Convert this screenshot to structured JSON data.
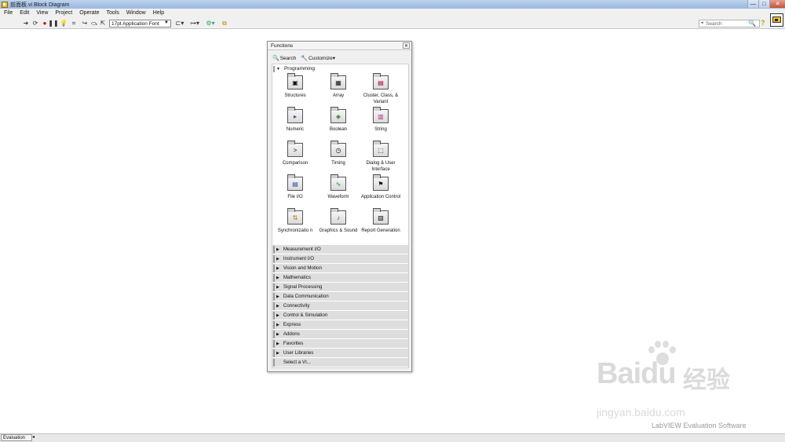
{
  "window": {
    "title": "前面板.vi Block Diagram",
    "controls": [
      "—",
      "□",
      "✕"
    ]
  },
  "menu": [
    "File",
    "Edit",
    "View",
    "Project",
    "Operate",
    "Tools",
    "Window",
    "Help"
  ],
  "toolbar": {
    "font": "17pt Application Font",
    "search_placeholder": "Search"
  },
  "palette": {
    "title": "Functions",
    "search_label": "Search",
    "customize_label": "Customize▾",
    "expanded_category": "Programming",
    "functions": [
      {
        "label": "Structures",
        "icon": "structures-icon"
      },
      {
        "label": "Array",
        "icon": "array-icon"
      },
      {
        "label": "Cluster, Class, & Variant",
        "icon": "cluster-icon"
      },
      {
        "label": "Numeric",
        "icon": "numeric-icon"
      },
      {
        "label": "Boolean",
        "icon": "boolean-icon"
      },
      {
        "label": "String",
        "icon": "string-icon"
      },
      {
        "label": "Comparison",
        "icon": "comparison-icon"
      },
      {
        "label": "Timing",
        "icon": "timing-icon"
      },
      {
        "label": "Dialog & User Interface",
        "icon": "dialog-icon"
      },
      {
        "label": "File I/O",
        "icon": "file-io-icon"
      },
      {
        "label": "Waveform",
        "icon": "waveform-icon"
      },
      {
        "label": "Application Control",
        "icon": "app-control-icon"
      },
      {
        "label": "Synchronizatio n",
        "icon": "sync-icon"
      },
      {
        "label": "Graphics & Sound",
        "icon": "graphics-icon"
      },
      {
        "label": "Report Generation",
        "icon": "report-icon"
      }
    ],
    "categories": [
      "Measurement I/O",
      "Instrument I/O",
      "Vision and Motion",
      "Mathematics",
      "Signal Processing",
      "Data Communication",
      "Connectivity",
      "Control & Simulation",
      "Express",
      "Addons",
      "Favorites",
      "User Libraries",
      "Select a VI..."
    ]
  },
  "status": {
    "tab": "Evaluation"
  },
  "watermark": {
    "logo": "Baidu",
    "cn": "经验",
    "url": "jingyan.baidu.com",
    "eval": "LabVIEW Evaluation Software"
  }
}
